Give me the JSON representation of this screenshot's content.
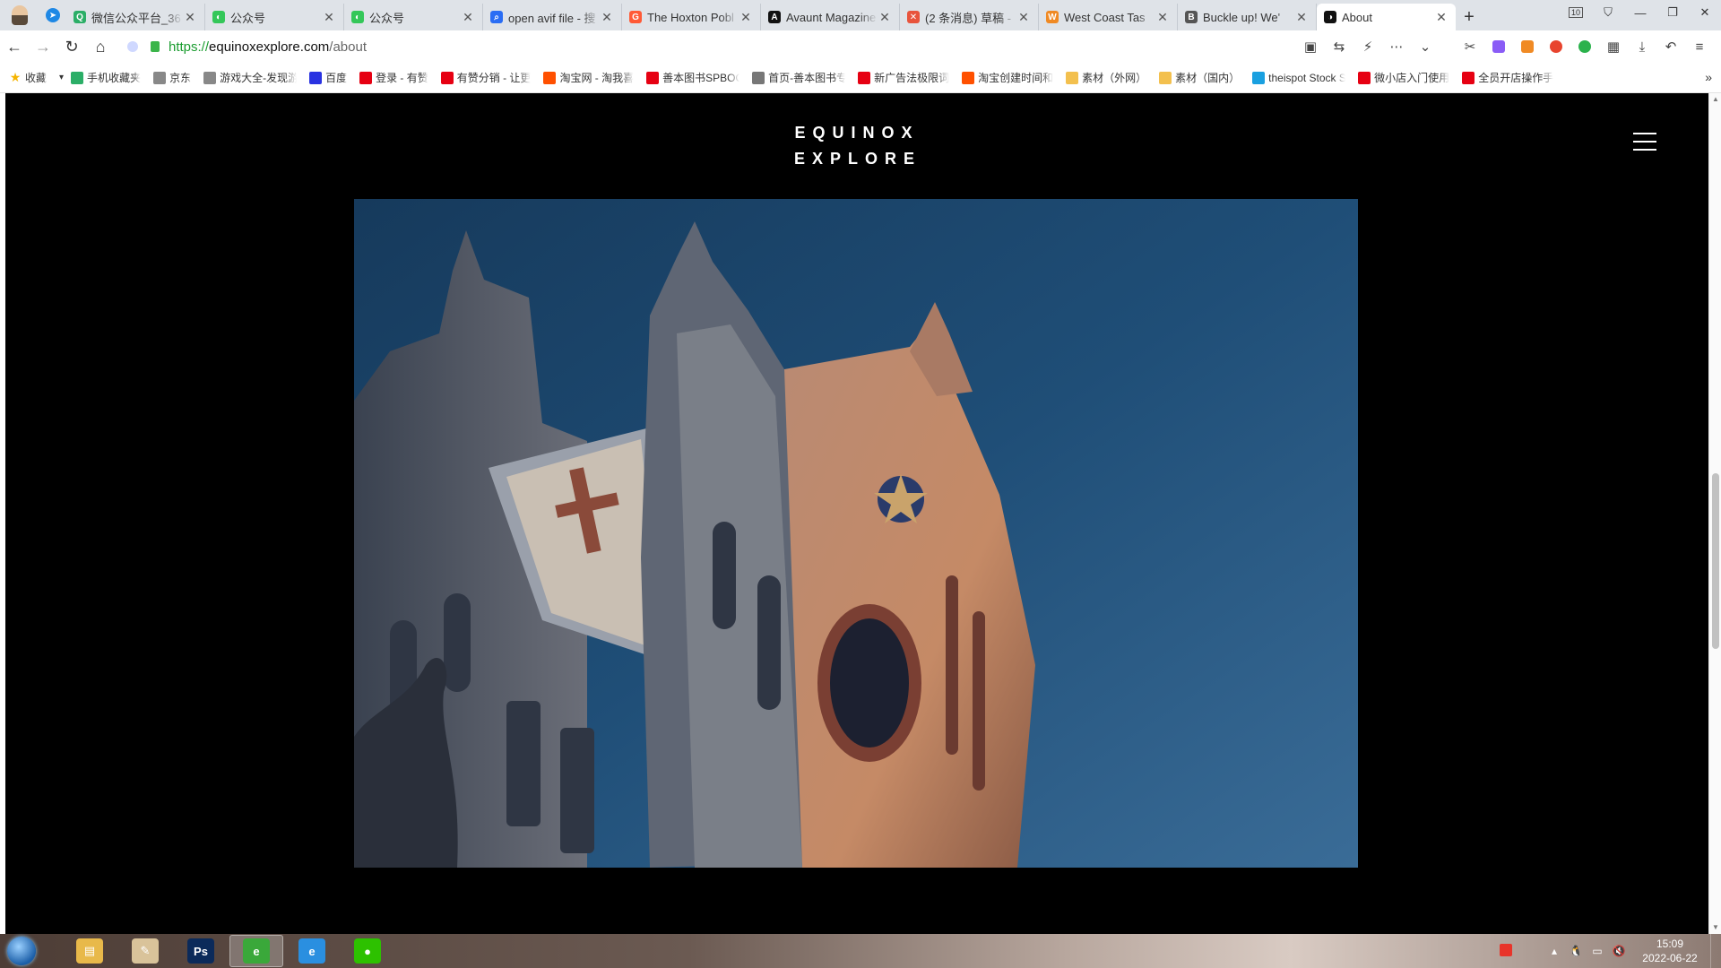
{
  "browser": {
    "tabs": [
      {
        "title": "微信公众平台_36",
        "fav_color": "#2bae67",
        "fav_glyph": "Q"
      },
      {
        "title": "公众号",
        "fav_color": "#34c759",
        "fav_glyph": "◐"
      },
      {
        "title": "公众号",
        "fav_color": "#34c759",
        "fav_glyph": "◐"
      },
      {
        "title": "open avif file - 搜",
        "fav_color": "#2a6df4",
        "fav_glyph": "⌕"
      },
      {
        "title": "The Hoxton Pobl",
        "fav_color": "#ff5a36",
        "fav_glyph": "G"
      },
      {
        "title": "Avaunt Magazine",
        "fav_color": "#111111",
        "fav_glyph": "A"
      },
      {
        "title": "(2 条消息) 草稿 -",
        "fav_color": "#e8543c",
        "fav_glyph": "✕"
      },
      {
        "title": "West Coast Tas",
        "fav_color": "#f08a24",
        "fav_glyph": "W"
      },
      {
        "title": "Buckle up! We'",
        "fav_color": "#555555",
        "fav_glyph": "B"
      },
      {
        "title": "About",
        "fav_color": "#111111",
        "fav_glyph": "◑",
        "active": true
      }
    ],
    "tab_count_badge": "10",
    "address": {
      "scheme": "https://",
      "host": "equinoxexplore.com",
      "path": "/about"
    },
    "bookmarks": [
      {
        "label": "收藏",
        "icon": "star-icon",
        "color": "#f5b400"
      },
      {
        "label": "手机收藏夹",
        "icon": "phone-icon",
        "color": "#2bae67"
      },
      {
        "label": "京东",
        "icon": "globe-icon",
        "color": "#888888"
      },
      {
        "label": "游戏大全-发现游",
        "icon": "globe-icon",
        "color": "#888888"
      },
      {
        "label": "百度",
        "icon": "paw-icon",
        "color": "#2932e1"
      },
      {
        "label": "登录 - 有赞",
        "icon": "youzan-icon",
        "color": "#e60012"
      },
      {
        "label": "有赞分销 - 让更",
        "icon": "youzan-icon",
        "color": "#e60012"
      },
      {
        "label": "淘宝网 - 淘我喜",
        "icon": "taobao-icon",
        "color": "#ff5000"
      },
      {
        "label": "善本图书SPBOO",
        "icon": "sp-icon",
        "color": "#e60012"
      },
      {
        "label": "首页-善本图书专",
        "icon": "doc-icon",
        "color": "#777777"
      },
      {
        "label": "新广告法极限词",
        "icon": "fk-icon",
        "color": "#e60012"
      },
      {
        "label": "淘宝创建时间和",
        "icon": "taobao-icon",
        "color": "#ff5000"
      },
      {
        "label": "素材（外网）",
        "icon": "folder-icon",
        "color": "#f3c04e"
      },
      {
        "label": "素材（国内）",
        "icon": "folder-icon",
        "color": "#f3c04e"
      },
      {
        "label": "theispot Stock S",
        "icon": "info-icon",
        "color": "#1aa0e0"
      },
      {
        "label": "微小店入门使用",
        "icon": "youzan-icon",
        "color": "#e60012"
      },
      {
        "label": "全员开店操作手",
        "icon": "youzan-icon",
        "color": "#e60012"
      }
    ]
  },
  "site": {
    "logo_line1": "EQUINOX",
    "logo_line2": "EXPLORE",
    "hero_alt": "Gothic cathedral facade lit at dusk"
  },
  "taskbar": {
    "apps": [
      {
        "name": "explorer",
        "color": "#e8b94a",
        "glyph": "▤"
      },
      {
        "name": "paint",
        "color": "#d9c39a",
        "glyph": "✎"
      },
      {
        "name": "photoshop",
        "color": "#0b2a5a",
        "glyph": "Ps"
      },
      {
        "name": "browser-360",
        "color": "#3aa83a",
        "glyph": "e",
        "active": true
      },
      {
        "name": "internet-explorer",
        "color": "#2a8fe0",
        "glyph": "e"
      },
      {
        "name": "wechat",
        "color": "#2dc100",
        "glyph": "●"
      }
    ],
    "time": "15:09",
    "date": "2022-06-22"
  }
}
